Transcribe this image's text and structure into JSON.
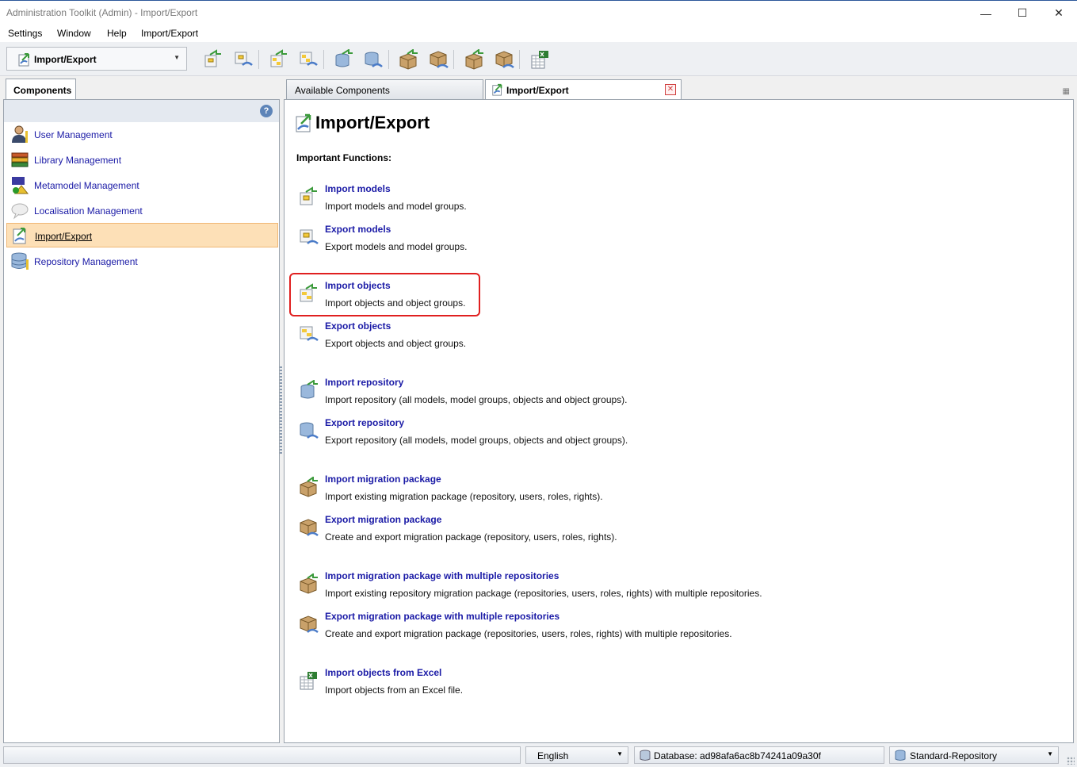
{
  "window": {
    "title": "Administration Toolkit (Admin) - Import/Export",
    "minimize": "—",
    "maximize": "☐",
    "close": "✕"
  },
  "menu": [
    {
      "label": "Settings"
    },
    {
      "label": "Window"
    },
    {
      "label": "Help"
    },
    {
      "label": "Import/Export"
    }
  ],
  "toolbar": {
    "component_select": "Import/Export",
    "buttons": [
      "import-models-icon",
      "export-models-icon",
      "import-objects-icon",
      "export-objects-icon",
      "import-repository-icon",
      "export-repository-icon",
      "import-migration-icon",
      "export-migration-icon",
      "import-migration-multi-icon",
      "export-migration-multi-icon",
      "import-excel-icon"
    ]
  },
  "left_panel": {
    "tab": "Components",
    "items": [
      {
        "label": "User Management",
        "icon": "user-icon"
      },
      {
        "label": "Library Management",
        "icon": "library-icon"
      },
      {
        "label": "Metamodel Management",
        "icon": "metamodel-icon"
      },
      {
        "label": "Localisation Management",
        "icon": "speech-bubble-icon"
      },
      {
        "label": "Import/Export",
        "icon": "import-export-icon",
        "selected": true
      },
      {
        "label": "Repository Management",
        "icon": "database-icon"
      }
    ]
  },
  "tabs": {
    "available": "Available Components",
    "active": "Import/Export"
  },
  "main": {
    "title": "Import/Export",
    "subheading": "Important Functions:",
    "functions": [
      {
        "title": "Import models",
        "desc": "Import models and model groups."
      },
      {
        "title": "Export models",
        "desc": "Export models and model groups."
      },
      {
        "title": "Import objects",
        "desc": "Import objects and object groups.",
        "highlighted": true
      },
      {
        "title": "Export objects",
        "desc": "Export objects and object groups."
      },
      {
        "title": "Import repository",
        "desc": "Import repository (all models, model groups, objects and object groups)."
      },
      {
        "title": "Export repository",
        "desc": "Export repository (all models, model groups, objects and object groups)."
      },
      {
        "title": "Import migration package",
        "desc": "Import existing migration package (repository, users, roles, rights)."
      },
      {
        "title": "Export migration package",
        "desc": "Create and export migration package (repository, users, roles, rights)."
      },
      {
        "title": "Import migration package with multiple repositories",
        "desc": "Import existing repository migration package (repositories, users, roles, rights) with multiple repositories."
      },
      {
        "title": "Export migration package with multiple repositories",
        "desc": "Create and export migration package (repositories, users, roles, rights) with multiple repositories."
      },
      {
        "title": "Import objects from Excel",
        "desc": "Import objects from an Excel file."
      }
    ]
  },
  "status": {
    "language": "English",
    "database": "Database: ad98afa6ac8b74241a09a30f",
    "repository": "Standard-Repository"
  },
  "colors": {
    "link": "#1a1aa6",
    "selected_bg": "#fde0b7",
    "highlight_border": "#e02020"
  }
}
